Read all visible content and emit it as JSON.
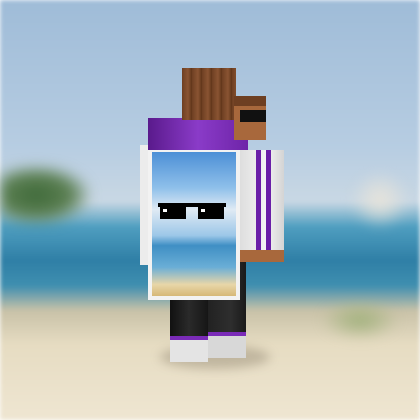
{
  "scene": {
    "type": "minecraft-skin-preview",
    "view": "back-three-quarter",
    "background": "blurred-beach",
    "colors": {
      "sky": "#a9c4dc",
      "sea": "#3f8fb0",
      "sand": "#e8dcc0",
      "hair": "#7a4a2c",
      "hood": "#7a2bb8",
      "jacket": "#eeeeee",
      "stripe": "#6a1fa8",
      "pants": "#1c1c1c",
      "skin": "#a8683c"
    },
    "cape": {
      "image": "beach-with-sunglasses"
    }
  }
}
